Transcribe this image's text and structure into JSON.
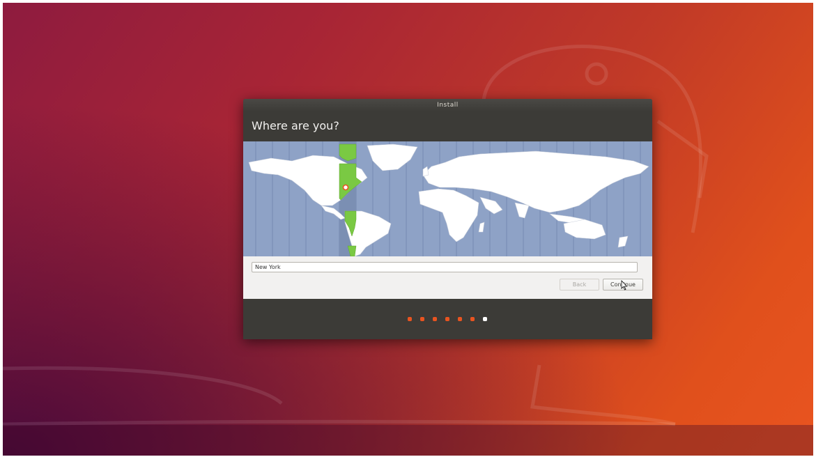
{
  "window": {
    "title": "Install",
    "heading": "Where are you?"
  },
  "map": {
    "selected_timezone_color": "#7ac943",
    "ocean_color": "#8ea2c6",
    "land_color": "#ffffff",
    "marker_color": "#e95420"
  },
  "location": {
    "value": "New York"
  },
  "buttons": {
    "back_label": "Back",
    "continue_label": "Continue"
  },
  "progress": {
    "total_steps": 7,
    "current_step": 7,
    "active_color": "#e95420",
    "current_color": "#ffffff"
  },
  "colors": {
    "accent": "#e95420",
    "window_dark": "#3c3b37"
  }
}
